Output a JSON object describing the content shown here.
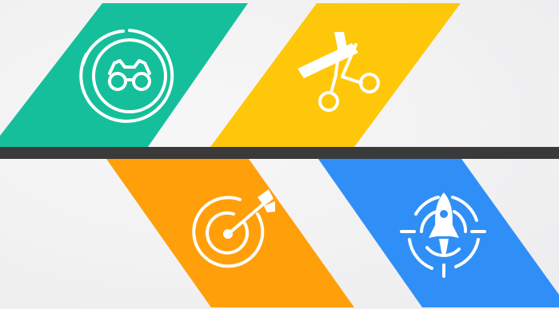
{
  "colors": {
    "background": "#f3f3f4",
    "divider": "#3a3a3a",
    "panel_green": "#15bf9b",
    "panel_yellow": "#ffc70a",
    "panel_orange": "#ff9f0a",
    "panel_blue": "#2f8ff6",
    "icon": "#ffffff"
  },
  "panels": [
    {
      "icon": "binoculars-icon",
      "color": "panel_green"
    },
    {
      "icon": "scissors-icon",
      "color": "panel_yellow"
    },
    {
      "icon": "target-arrow-icon",
      "color": "panel_orange"
    },
    {
      "icon": "rocket-icon",
      "color": "panel_blue"
    }
  ]
}
